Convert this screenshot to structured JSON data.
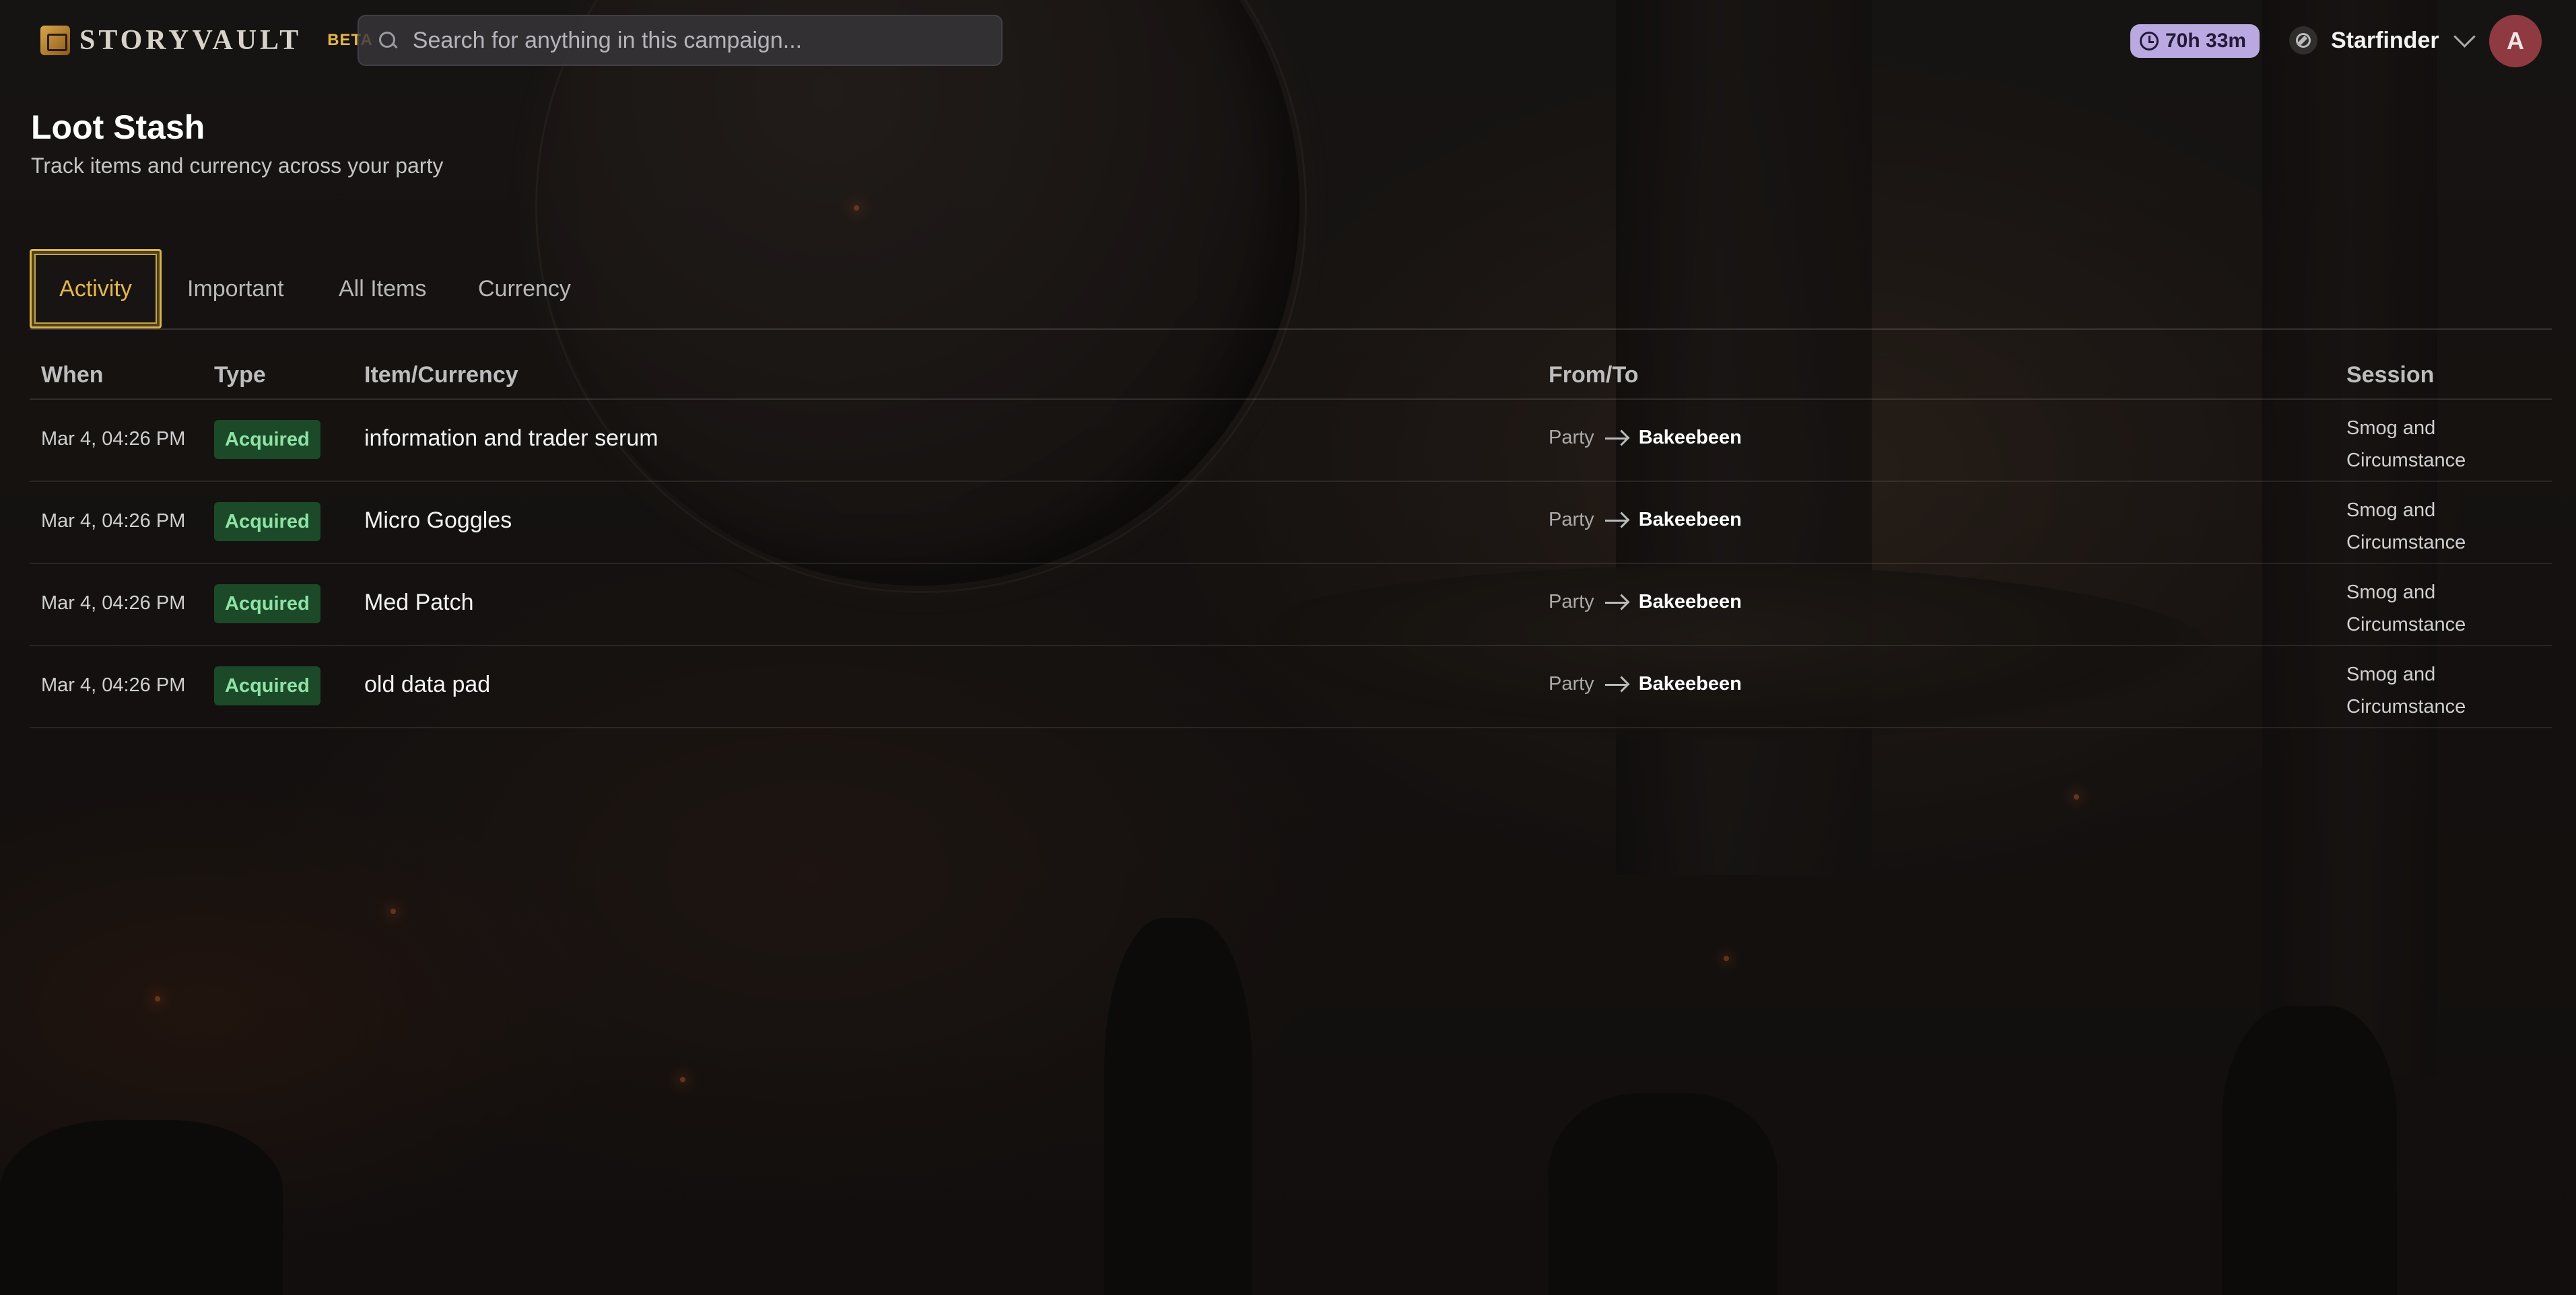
{
  "header": {
    "brand": "STORYVAULT",
    "beta_label": "BETA",
    "search_placeholder": "Search for anything in this campaign...",
    "timer": "70h 33m",
    "campaign": "Starfinder",
    "avatar_initial": "A"
  },
  "page": {
    "title": "Loot Stash",
    "subtitle": "Track items and currency across your party"
  },
  "tabs": [
    {
      "label": "Activity",
      "active": true
    },
    {
      "label": "Important",
      "active": false
    },
    {
      "label": "All Items",
      "active": false
    },
    {
      "label": "Currency",
      "active": false
    }
  ],
  "table": {
    "columns": [
      "When",
      "Type",
      "Item/Currency",
      "From/To",
      "Session"
    ],
    "rows": [
      {
        "when": "Mar 4, 04:26 PM",
        "type": "Acquired",
        "item": "information and trader serum",
        "from": "Party",
        "to": "Bakeebeen",
        "session_line1": "Smog and",
        "session_line2": "Circumstance"
      },
      {
        "when": "Mar 4, 04:26 PM",
        "type": "Acquired",
        "item": "Micro Goggles",
        "from": "Party",
        "to": "Bakeebeen",
        "session_line1": "Smog and",
        "session_line2": "Circumstance"
      },
      {
        "when": "Mar 4, 04:26 PM",
        "type": "Acquired",
        "item": "Med Patch",
        "from": "Party",
        "to": "Bakeebeen",
        "session_line1": "Smog and",
        "session_line2": "Circumstance"
      },
      {
        "when": "Mar 4, 04:26 PM",
        "type": "Acquired",
        "item": "old data pad",
        "from": "Party",
        "to": "Bakeebeen",
        "session_line1": "Smog and",
        "session_line2": "Circumstance"
      }
    ]
  },
  "colors": {
    "accent_gold": "#e5b84a",
    "badge_bg": "#1c4a29",
    "badge_text": "#8ee3a5",
    "timer_bg": "#b9a9e0",
    "avatar_bg": "#8f3a40"
  },
  "icons": [
    "logo-icon",
    "search-icon",
    "clock-icon",
    "compass-icon",
    "chevron-down-icon",
    "arrow-right-icon"
  ]
}
